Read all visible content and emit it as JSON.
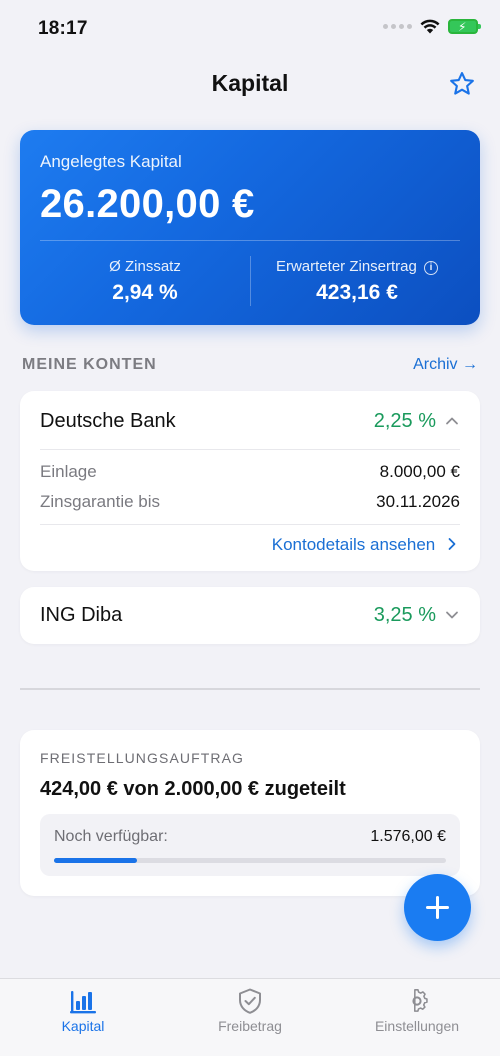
{
  "status_bar": {
    "time": "18:17",
    "icons": [
      "signal-dots-icon",
      "wifi-icon",
      "battery-charging-icon"
    ]
  },
  "nav": {
    "title": "Kapital",
    "favorite_icon": "star-outline-icon"
  },
  "hero": {
    "label": "Angelegtes Kapital",
    "amount": "26.200,00 €",
    "avg_rate_label": "Ø Zinssatz",
    "avg_rate_value": "2,94 %",
    "expected_label": "Erwarteter Zinsertrag",
    "expected_value": "423,16 €",
    "info_icon": "info-icon"
  },
  "accounts_section": {
    "title": "MEINE KONTEN",
    "archive_link": "Archiv →"
  },
  "accounts": [
    {
      "name": "Deutsche Bank",
      "rate": "2,25 %",
      "expanded": true,
      "deposit_label": "Einlage",
      "deposit_value": "8.000,00 €",
      "guarantee_label": "Zinsgarantie bis",
      "guarantee_value": "30.11.2026",
      "details_link": "Kontodetails ansehen"
    },
    {
      "name": "ING Diba",
      "rate": "3,25 %",
      "expanded": false
    }
  ],
  "freistellung": {
    "title": "FREISTELLUNGSAUFTRAG",
    "summary": "424,00 € von 2.000,00 € zugeteilt",
    "available_label": "Noch verfügbar:",
    "available_value": "1.576,00 €",
    "progress_percent": 21.2
  },
  "fab": {
    "icon": "plus-icon"
  },
  "tabbar": {
    "tabs": [
      {
        "label": "Kapital",
        "icon": "bar-chart-icon",
        "active": true
      },
      {
        "label": "Freibetrag",
        "icon": "shield-check-icon",
        "active": false
      },
      {
        "label": "Einstellungen",
        "icon": "gear-icon",
        "active": false
      }
    ]
  },
  "colors": {
    "accent": "#1a73e8",
    "positive": "#1a9a5c",
    "hero_start": "#1e7cf0",
    "hero_end": "#0c4fc0"
  }
}
